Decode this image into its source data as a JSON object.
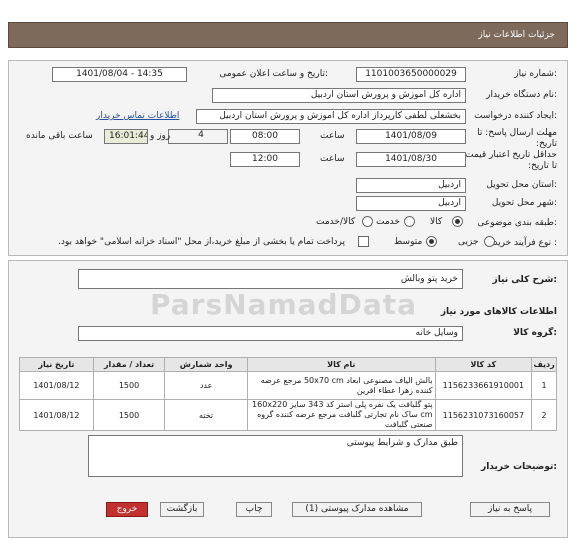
{
  "header": {
    "title": "جزئیات اطلاعات نیاز"
  },
  "fields": {
    "need_number_label": "شماره نیاز:",
    "need_number": "1101003650000029",
    "announce_label": "تاریخ و ساعت اعلان عمومی:",
    "announce_value": "1401/08/04 - 14:35",
    "buyer_org_label": "نام دستگاه خریدار:",
    "buyer_org": "اداره کل اموزش و پرورش استان اردبیل",
    "creator_label": "ایجاد کننده درخواست:",
    "creator": "بخشعلی لطفی کارپرداز اداره کل اموزش و پرورش استان اردبیل",
    "contact_link": "اطلاعات تماس خریدار",
    "reply_deadline_label": "مهلت ارسال پاسخ: تا تاریخ:",
    "reply_date": "1401/08/09",
    "time_label": "ساعت",
    "reply_time": "08:00",
    "days_value": "4",
    "days_label": "روز و",
    "remaining_time": "16:01:44",
    "remaining_label": "ساعت باقی مانده",
    "validity_label": "حداقل تاریخ اعتبار قیمت: تا تاریخ:",
    "validity_date": "1401/08/30",
    "validity_time": "12:00",
    "province_label": "استان محل تحویل:",
    "province": "اردبیل",
    "city_label": "شهر محل تحویل:",
    "city": "اردبیل",
    "category_label": "طبقه بندی موضوعی:",
    "category_options": [
      "کالا",
      "خدمت",
      "کالا/خدمت"
    ],
    "process_label": "نوع فرآیند خرید :",
    "process_options": [
      "جزیی",
      "متوسط"
    ],
    "payment_note": "پرداخت تمام یا بخشی از مبلغ خرید،از محل \"اسناد خزانه اسلامی\" خواهد بود."
  },
  "summary": {
    "label": "شرح کلی نیاز:",
    "value": "خرید پتو وبالش"
  },
  "goods_section": {
    "title": "اطلاعات کالاهای مورد نیاز",
    "group_label": "گروه کالا:",
    "group_value": "وسایل خانه",
    "columns": [
      "ردیف",
      "کد کالا",
      "نام کالا",
      "واحد شمارش",
      "تعداد / مقدار",
      "تاریخ نیاز"
    ],
    "rows": [
      {
        "row": "1",
        "code": "1156233661910001",
        "name": "بالش الیاف مصنوعی ابعاد 50x70 cm مرجع عرضه کننده زهرا عطاء افرین",
        "unit": "عدد",
        "qty": "1500",
        "date": "1401/08/12"
      },
      {
        "row": "2",
        "code": "1156231073160057",
        "name": "پتو گلبافت یک نفره پلی استر کد 343 سایز 160x220 cm ساک نام تجارتی گلبافت مرجع عرضه کننده گروه صنعتی گلبافت",
        "unit": "تخته",
        "qty": "1500",
        "date": "1401/08/12"
      }
    ]
  },
  "buyer_notes": {
    "label": "توضیحات خریدار:",
    "value": "طبق مدارک و شرایط پیوستی"
  },
  "footer_buttons": {
    "reply": "پاسخ به نیاز",
    "attachments": "مشاهده مدارک پیوستی (1)",
    "print": "چاپ",
    "back": "بازگشت",
    "exit": "خروج"
  },
  "watermark": "ParsNamadData"
}
